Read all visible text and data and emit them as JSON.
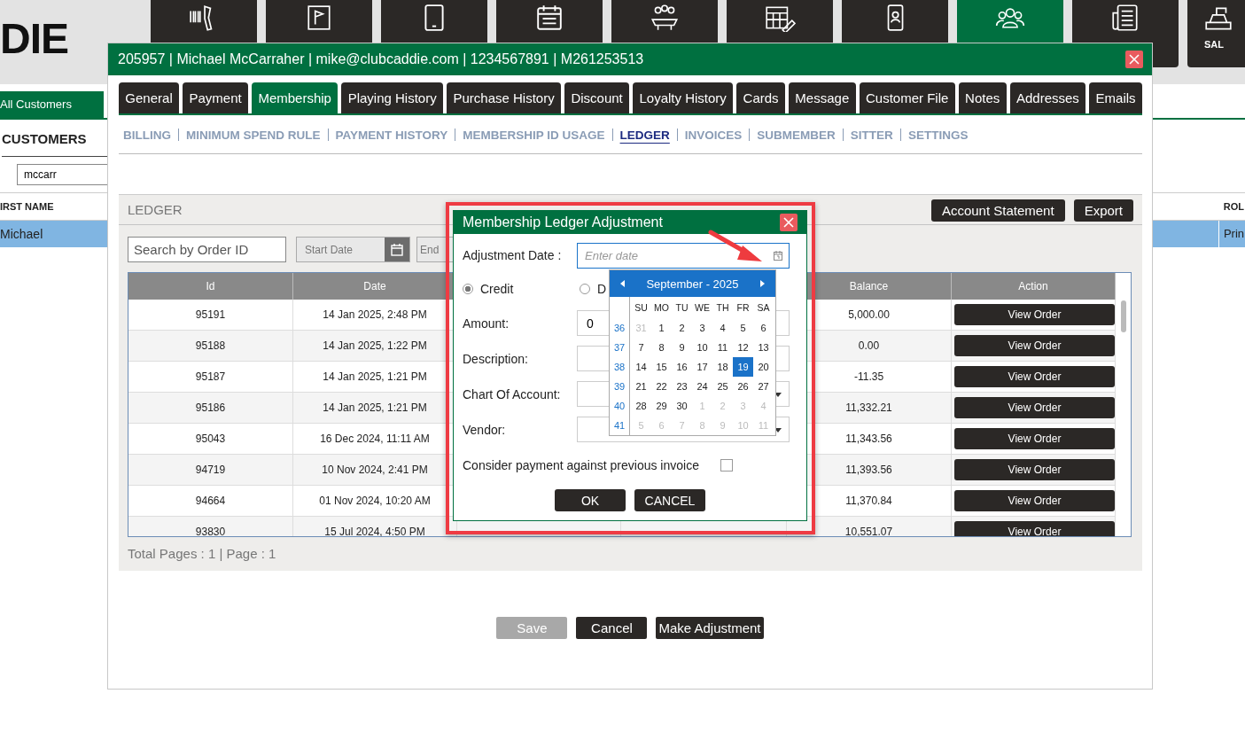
{
  "app": {
    "logo": "DIE",
    "tiles": [
      {
        "kind": "scanner",
        "selected": false
      },
      {
        "kind": "flag",
        "selected": false
      },
      {
        "kind": "tablet",
        "selected": false
      },
      {
        "kind": "calendar",
        "selected": false
      },
      {
        "kind": "meeting",
        "selected": false
      },
      {
        "kind": "schedule",
        "selected": false
      },
      {
        "kind": "phone",
        "selected": false
      },
      {
        "kind": "group",
        "selected": true
      },
      {
        "kind": "receipt",
        "selected": false
      },
      {
        "kind": "sales",
        "label": "SAL",
        "selected": false
      }
    ],
    "left_panel": {
      "tab": {
        "label": "All Customers",
        "selected": true
      },
      "heading": "CUSTOMERS",
      "search_value": "mccarr",
      "first_name_header": "IRST NAME",
      "role_header": "ROL",
      "row": {
        "first_name": "Michael",
        "role": "Prin",
        "selected": true
      }
    }
  },
  "dialog": {
    "title": "205957 | Michael McCarraher | mike@clubcaddie.com | 1234567891 | M261253513",
    "tabs": [
      {
        "label": "General",
        "selected": false
      },
      {
        "label": "Payment",
        "selected": false
      },
      {
        "label": "Membership",
        "selected": true
      },
      {
        "label": "Playing History",
        "selected": false
      },
      {
        "label": "Purchase History",
        "selected": false
      },
      {
        "label": "Discount",
        "selected": false
      },
      {
        "label": "Loyalty History",
        "selected": false
      },
      {
        "label": "Cards",
        "selected": false
      },
      {
        "label": "Message",
        "selected": false
      },
      {
        "label": "Customer File",
        "selected": false
      },
      {
        "label": "Notes",
        "selected": false
      },
      {
        "label": "Addresses",
        "selected": false
      },
      {
        "label": "Emails",
        "selected": false
      }
    ],
    "subtabs": [
      {
        "label": "BILLING",
        "selected": false
      },
      {
        "label": "MINIMUM SPEND RULE",
        "selected": false
      },
      {
        "label": "PAYMENT HISTORY",
        "selected": false
      },
      {
        "label": "MEMBERSHIP ID USAGE",
        "selected": false
      },
      {
        "label": "LEDGER",
        "selected": true
      },
      {
        "label": "INVOICES",
        "selected": false
      },
      {
        "label": "SUBMEMBER",
        "selected": false
      },
      {
        "label": "SITTER",
        "selected": false
      },
      {
        "label": "SETTINGS",
        "selected": false
      }
    ],
    "ledger": {
      "title": "LEDGER",
      "buttons": [
        "Account Statement",
        "Export"
      ],
      "search": {
        "placeholder": "Search by Order ID"
      },
      "start_date": {
        "placeholder": "Start Date"
      },
      "end_date": {
        "placeholder": "End"
      },
      "columns": [
        "Id",
        "Date",
        "Balance",
        "Action"
      ],
      "rows": [
        {
          "id": "95191",
          "date": "14 Jan 2025, 2:48 PM",
          "balance": "5,000.00",
          "action": "View Order"
        },
        {
          "id": "95188",
          "date": "14 Jan 2025, 1:22 PM",
          "balance": "0.00",
          "action": "View Order"
        },
        {
          "id": "95187",
          "date": "14 Jan 2025, 1:21 PM",
          "balance": "-11.35",
          "action": "View Order"
        },
        {
          "id": "95186",
          "date": "14 Jan 2025, 1:21 PM",
          "balance": "11,332.21",
          "action": "View Order"
        },
        {
          "id": "95043",
          "date": "16 Dec 2024, 11:11 AM",
          "balance": "11,343.56",
          "action": "View Order"
        },
        {
          "id": "94719",
          "date": "10 Nov 2024, 2:41 PM",
          "balance": "11,393.56",
          "action": "View Order"
        },
        {
          "id": "94664",
          "date": "01 Nov 2024, 10:20 AM",
          "balance": "11,370.84",
          "action": "View Order"
        },
        {
          "id": "93830",
          "date": "15 Jul 2024, 4:50 PM",
          "balance": "10,551.07",
          "action": "View Order"
        }
      ],
      "footer": "Total Pages : 1 | Page : 1"
    },
    "buttons": [
      {
        "label": "Save",
        "disabled": true
      },
      {
        "label": "Cancel",
        "disabled": false
      },
      {
        "label": "Make Adjustment",
        "disabled": false
      }
    ]
  },
  "adjustment_modal": {
    "title": "Membership Ledger Adjustment",
    "adjustment_date": {
      "label": "Adjustment Date :",
      "placeholder": "Enter date"
    },
    "types": [
      {
        "label": "Credit",
        "selected": true
      },
      {
        "label": "D",
        "selected": false
      }
    ],
    "amount": {
      "label": "Amount:",
      "value": "0"
    },
    "description": {
      "label": "Description:"
    },
    "chart_of_account": {
      "label": "Chart Of Account:"
    },
    "vendor": {
      "label": "Vendor:"
    },
    "consider_previous": {
      "label": "Consider payment against previous invoice",
      "checked": false
    },
    "buttons": [
      "OK",
      "CANCEL"
    ],
    "calendar": {
      "title": "September - 2025",
      "weekdays": [
        "SU",
        "MO",
        "TU",
        "WE",
        "TH",
        "FR",
        "SA"
      ],
      "weeks": [
        {
          "number": "36",
          "days": [
            {
              "day": "31",
              "outside": true,
              "selected": false
            },
            {
              "day": "1",
              "outside": false,
              "selected": false
            },
            {
              "day": "2",
              "outside": false,
              "selected": false
            },
            {
              "day": "3",
              "outside": false,
              "selected": false
            },
            {
              "day": "4",
              "outside": false,
              "selected": false
            },
            {
              "day": "5",
              "outside": false,
              "selected": false
            },
            {
              "day": "6",
              "outside": false,
              "selected": false
            }
          ]
        },
        {
          "number": "37",
          "days": [
            {
              "day": "7",
              "outside": false,
              "selected": false
            },
            {
              "day": "8",
              "outside": false,
              "selected": false
            },
            {
              "day": "9",
              "outside": false,
              "selected": false
            },
            {
              "day": "10",
              "outside": false,
              "selected": false
            },
            {
              "day": "11",
              "outside": false,
              "selected": false
            },
            {
              "day": "12",
              "outside": false,
              "selected": false
            },
            {
              "day": "13",
              "outside": false,
              "selected": false
            }
          ]
        },
        {
          "number": "38",
          "days": [
            {
              "day": "14",
              "outside": false,
              "selected": false
            },
            {
              "day": "15",
              "outside": false,
              "selected": false
            },
            {
              "day": "16",
              "outside": false,
              "selected": false
            },
            {
              "day": "17",
              "outside": false,
              "selected": false
            },
            {
              "day": "18",
              "outside": false,
              "selected": false
            },
            {
              "day": "19",
              "outside": false,
              "selected": true
            },
            {
              "day": "20",
              "outside": false,
              "selected": false
            }
          ]
        },
        {
          "number": "39",
          "days": [
            {
              "day": "21",
              "outside": false,
              "selected": false
            },
            {
              "day": "22",
              "outside": false,
              "selected": false
            },
            {
              "day": "23",
              "outside": false,
              "selected": false
            },
            {
              "day": "24",
              "outside": false,
              "selected": false
            },
            {
              "day": "25",
              "outside": false,
              "selected": false
            },
            {
              "day": "26",
              "outside": false,
              "selected": false
            },
            {
              "day": "27",
              "outside": false,
              "selected": false
            }
          ]
        },
        {
          "number": "40",
          "days": [
            {
              "day": "28",
              "outside": false,
              "selected": false
            },
            {
              "day": "29",
              "outside": false,
              "selected": false
            },
            {
              "day": "30",
              "outside": false,
              "selected": false
            },
            {
              "day": "1",
              "outside": true,
              "selected": false
            },
            {
              "day": "2",
              "outside": true,
              "selected": false
            },
            {
              "day": "3",
              "outside": true,
              "selected": false
            },
            {
              "day": "4",
              "outside": true,
              "selected": false
            }
          ]
        },
        {
          "number": "41",
          "days": [
            {
              "day": "5",
              "outside": true,
              "selected": false
            },
            {
              "day": "6",
              "outside": true,
              "selected": false
            },
            {
              "day": "7",
              "outside": true,
              "selected": false
            },
            {
              "day": "8",
              "outside": true,
              "selected": false
            },
            {
              "day": "9",
              "outside": true,
              "selected": false
            },
            {
              "day": "10",
              "outside": true,
              "selected": false
            },
            {
              "day": "11",
              "outside": true,
              "selected": false
            }
          ]
        }
      ]
    }
  }
}
